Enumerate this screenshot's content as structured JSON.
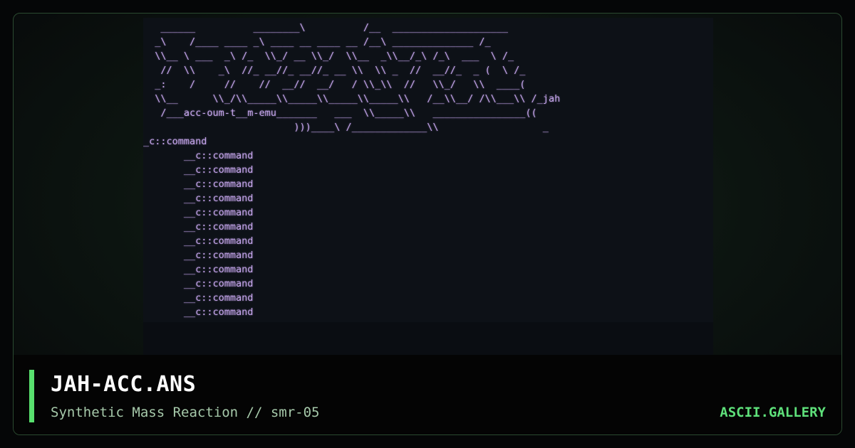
{
  "artwork": {
    "ascii_art": "   ______          ________\\          /__  ____________________\n  _\\    /____ ____ _\\ ____ __ ____ __ /__\\ ______________ /_\n  \\\\__ \\ ___  _\\ /_  \\\\_/ __ \\\\_/  \\\\__  _\\\\__/_\\ /_\\  ___  \\ /_\n   //  \\\\    _\\  //_ __//_ __//_ __ \\\\  \\\\ _  //  __//_  _ (  \\ /_\n  _:    /     //    //  __//  __/   / \\\\_\\\\  //   \\\\_/   \\\\  ____(\n  \\\\__      \\\\_/\\\\_____\\\\_____\\\\_____\\\\_____\\\\   /__\\\\__/ /\\\\___\\\\ /_jah\n   /___acc-oum-t__m-emu_______   ___  \\\\_____\\\\   ________________((\n                          )))____\\ /_____________\\\\                  _\n_c::command\n       __c::command\n       __c::command\n       __c::command\n       __c::command\n       __c::command\n       __c::command\n       __c::command\n       __c::command\n       __c::command\n       __c::command\n       __c::command\n       __c::command"
  },
  "caption": {
    "title": "JAH-ACC.ANS",
    "subtitle": "Synthetic Mass Reaction // smr-05",
    "brand": "ASCII.GALLERY"
  },
  "colors": {
    "accent": "#58e06e",
    "ascii_text": "#c3a4ea",
    "frame_border": "#2b4a30",
    "brand": "#5ee07a"
  }
}
